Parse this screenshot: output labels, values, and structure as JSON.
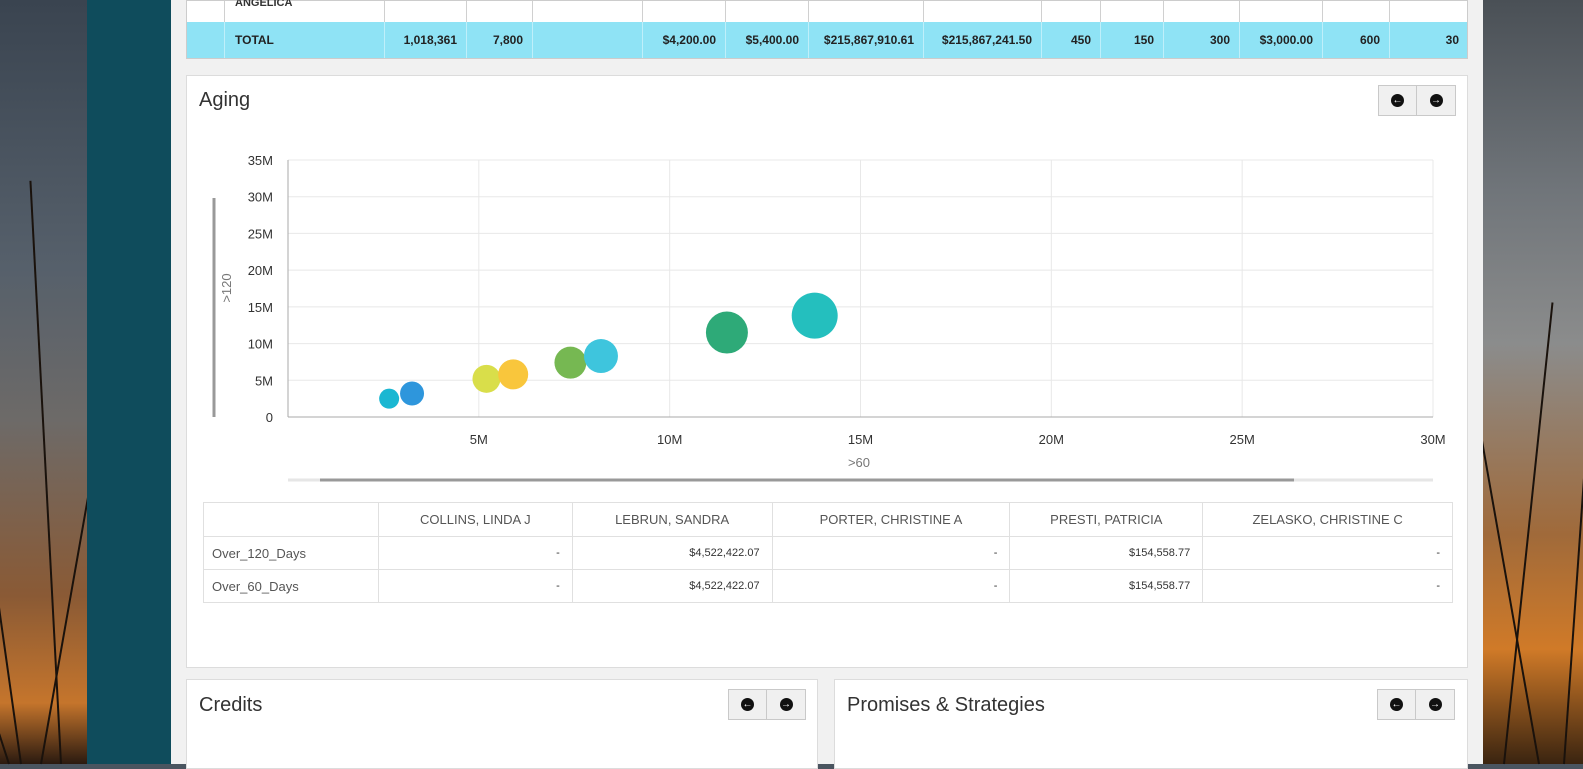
{
  "top_table": {
    "prev_row_name": "ANGELICA",
    "total": {
      "label": "TOTAL",
      "cells": [
        "1,018,361",
        "7,800",
        "",
        "$4,200.00",
        "$5,400.00",
        "$215,867,910.61",
        "$215,867,241.50",
        "450",
        "150",
        "300",
        "$3,000.00",
        "600",
        "30"
      ]
    }
  },
  "aging": {
    "title": "Aging",
    "prev_icon": "arrow-left-circle-icon",
    "next_icon": "arrow-right-circle-icon",
    "chart_data": {
      "type": "scatter",
      "xlabel": ">60",
      "ylabel": ">120",
      "xlim": [
        0,
        30000000
      ],
      "ylim": [
        0,
        35000000
      ],
      "x_ticks": [
        "5M",
        "10M",
        "15M",
        "20M",
        "25M",
        "30M"
      ],
      "y_ticks": [
        "0",
        "5M",
        "10M",
        "15M",
        "20M",
        "25M",
        "30M",
        "35M"
      ],
      "points": [
        {
          "x": 2650000,
          "y": 2500000,
          "size": 10,
          "color": "#1ab7d2"
        },
        {
          "x": 3250000,
          "y": 3200000,
          "size": 12,
          "color": "#2e96dc"
        },
        {
          "x": 5200000,
          "y": 5200000,
          "size": 14,
          "color": "#d9de4a"
        },
        {
          "x": 5900000,
          "y": 5800000,
          "size": 15,
          "color": "#f9c63c"
        },
        {
          "x": 7400000,
          "y": 7400000,
          "size": 16,
          "color": "#76b852"
        },
        {
          "x": 8200000,
          "y": 8300000,
          "size": 17,
          "color": "#3ec5dd"
        },
        {
          "x": 11500000,
          "y": 11500000,
          "size": 21,
          "color": "#2eaa78"
        },
        {
          "x": 13800000,
          "y": 13800000,
          "size": 23,
          "color": "#24bfbe"
        }
      ]
    },
    "table": {
      "columns": [
        "",
        "COLLINS, LINDA J",
        "LEBRUN, SANDRA",
        "PORTER, CHRISTINE A",
        "PRESTI, PATRICIA",
        "ZELASKO, CHRISTINE C"
      ],
      "rows": [
        {
          "label": "Over_120_Days",
          "values": [
            "-",
            "$4,522,422.07",
            "-",
            "$154,558.77",
            "-"
          ]
        },
        {
          "label": "Over_60_Days",
          "values": [
            "-",
            "$4,522,422.07",
            "-",
            "$154,558.77",
            "-"
          ]
        }
      ]
    }
  },
  "credits": {
    "title": "Credits"
  },
  "promises": {
    "title": "Promises & Strategies"
  },
  "colors": {
    "sidebar": "#0f4c5c",
    "total_row": "#8fe3f5"
  }
}
